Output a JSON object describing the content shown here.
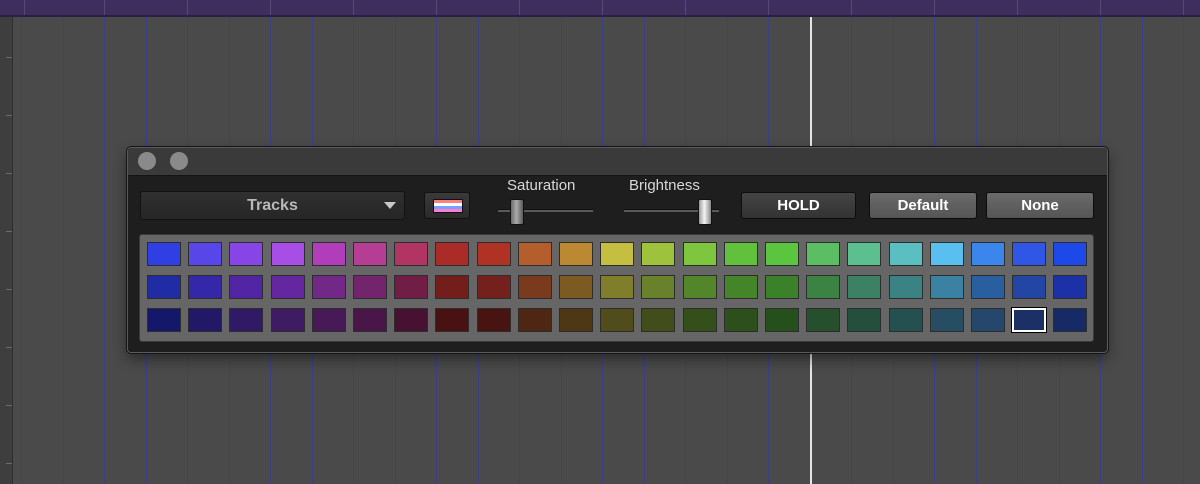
{
  "palette_window": {
    "controls": {
      "close_icon": "close-icon",
      "minimize_icon": "minimize-icon"
    },
    "dropdown": {
      "value": "Tracks",
      "icon": "chevron-down-icon"
    },
    "color_picker_icon": "color-swatch-icon",
    "saturation": {
      "label": "Saturation",
      "value_fraction": 0.2
    },
    "brightness": {
      "label": "Brightness",
      "value_fraction": 0.85
    },
    "buttons": {
      "hold": "HOLD",
      "default": "Default",
      "none": "None"
    },
    "palette": {
      "selected": {
        "row": 2,
        "col": 21
      },
      "rows": [
        [
          "#2f3fe4",
          "#5846e8",
          "#8744e6",
          "#a84ee6",
          "#b13dba",
          "#b53d94",
          "#b23463",
          "#ab2b27",
          "#b03225",
          "#b45e2d",
          "#bc8932",
          "#c4bf40",
          "#9fc23d",
          "#7dc63e",
          "#62c13c",
          "#5cc53f",
          "#5cbe62",
          "#5cbf8e",
          "#5bbec0",
          "#58bfef",
          "#3b86ec",
          "#2f56e6",
          "#1e49e9"
        ],
        [
          "#202ca3",
          "#3428a8",
          "#5125a3",
          "#65279f",
          "#722886",
          "#72246c",
          "#721d46",
          "#731e1a",
          "#74201c",
          "#7a3a1d",
          "#7c5a22",
          "#807d2b",
          "#6a812b",
          "#53862a",
          "#44852a",
          "#3b8129",
          "#3c8242",
          "#3c8163",
          "#3b8284",
          "#3a81a2",
          "#2a5f9f",
          "#2345a3",
          "#1c31a5"
        ],
        [
          "#15186a",
          "#211968",
          "#311a65",
          "#3e1b62",
          "#471a57",
          "#491649",
          "#471131",
          "#471211",
          "#481412",
          "#4d2614",
          "#4d3715",
          "#504c1b",
          "#414e1c",
          "#354f1a",
          "#2c4f1b",
          "#25501c",
          "#264f2d",
          "#244f3d",
          "#264f4f",
          "#274d63",
          "#24476b",
          "#1c3066",
          "#182a66"
        ]
      ]
    }
  }
}
